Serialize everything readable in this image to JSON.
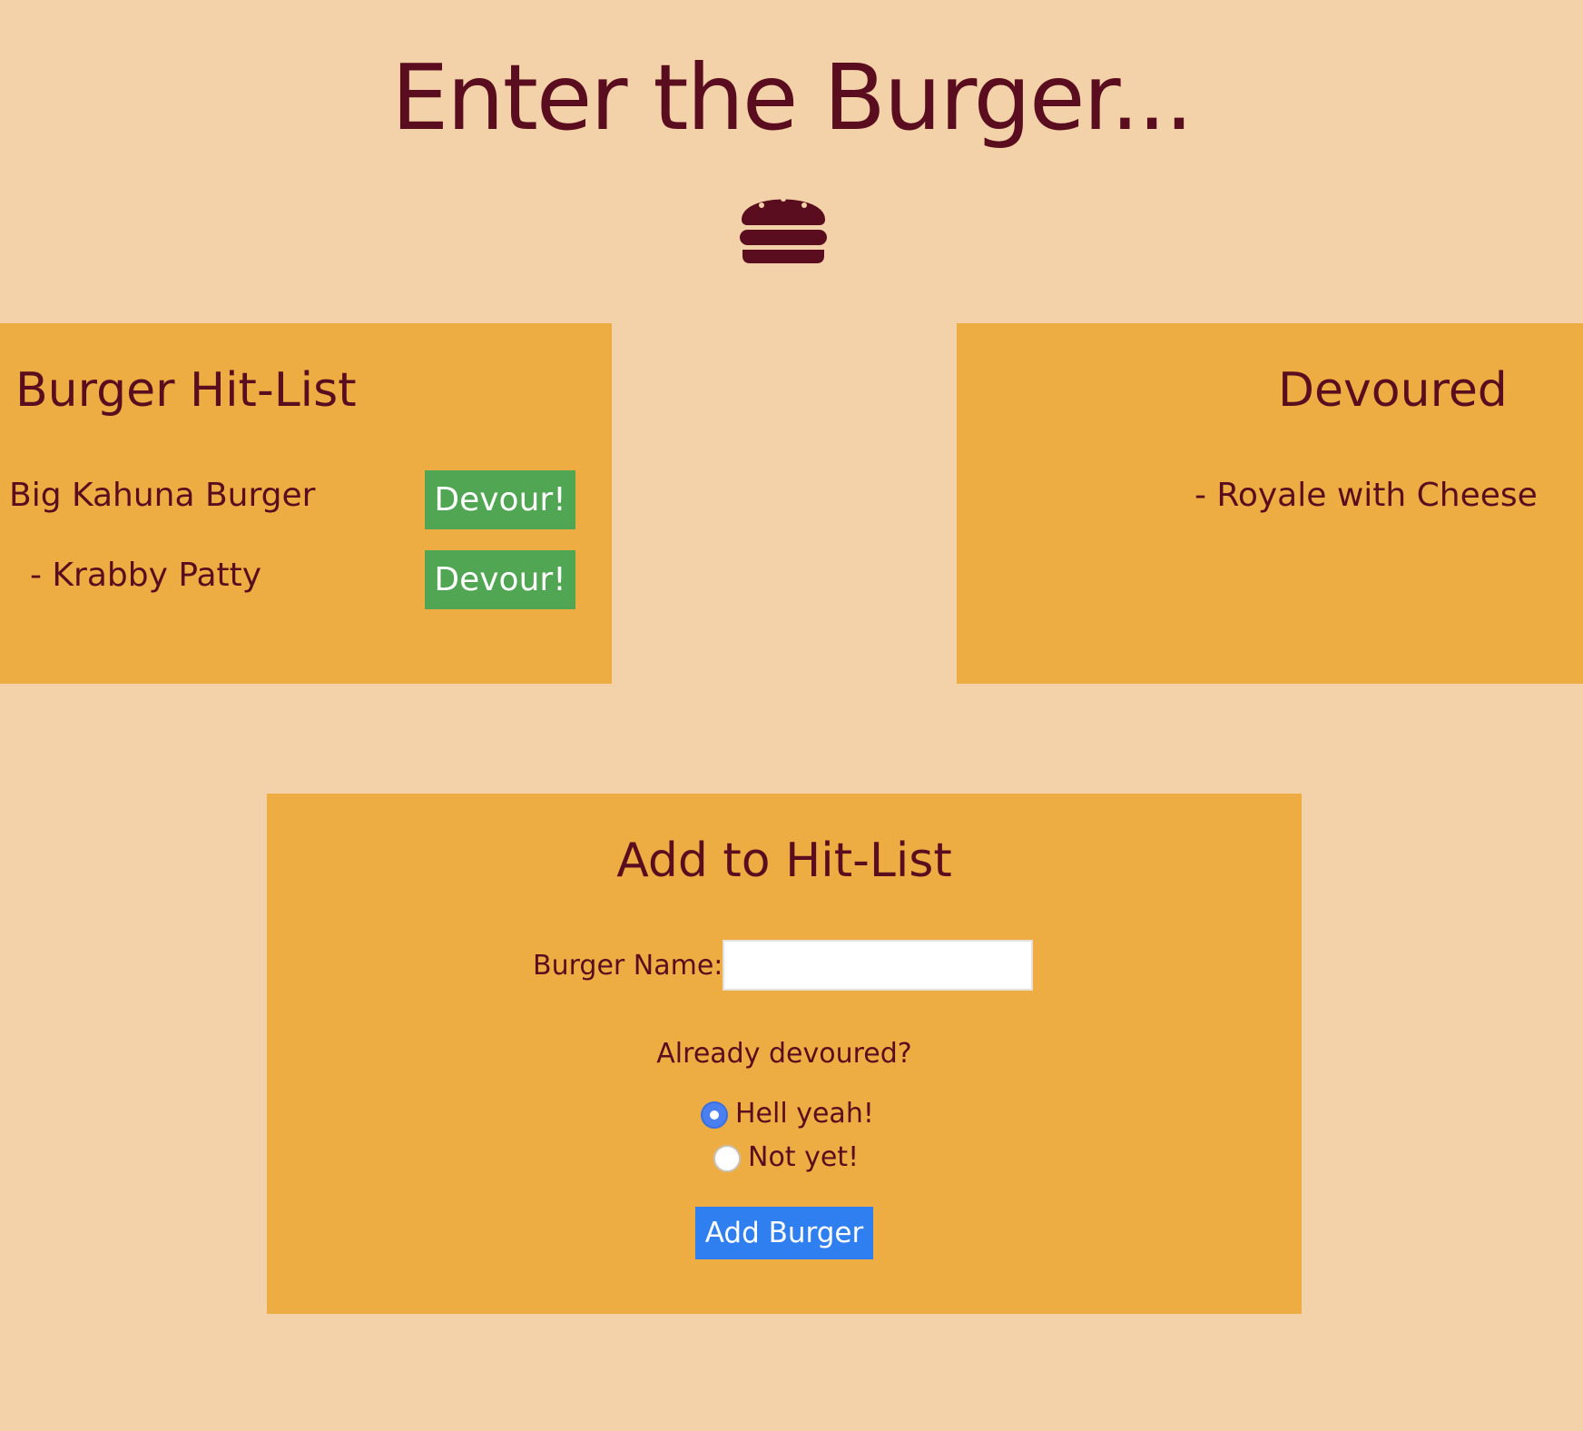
{
  "header": {
    "title": "Enter the Burger...",
    "icon": "burger-icon"
  },
  "hit_list": {
    "heading": "Burger Hit-List",
    "items": [
      {
        "name": "Big Kahuna Burger",
        "button_label": "Devour!"
      },
      {
        "name": "- Krabby Patty",
        "button_label": "Devour!"
      }
    ]
  },
  "devoured": {
    "heading": "Devoured",
    "items": [
      {
        "name": "- Royale with Cheese"
      }
    ]
  },
  "add_form": {
    "heading": "Add to Hit-List",
    "name_label": "Burger Name:",
    "name_value": "",
    "devoured_question": "Already devoured?",
    "options": [
      {
        "label": "Hell yeah!",
        "selected": true
      },
      {
        "label": "Not yet!",
        "selected": false
      }
    ],
    "submit_label": "Add Burger"
  },
  "colors": {
    "background": "#f4d2a9",
    "panel": "#edad43",
    "text": "#5a0d1e",
    "devour_button": "#50a653",
    "add_button": "#2f7ff0"
  }
}
